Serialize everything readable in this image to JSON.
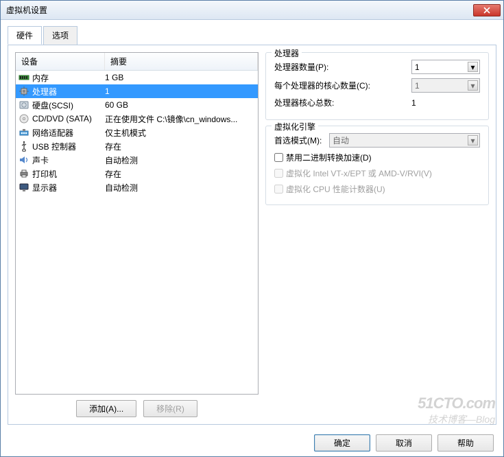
{
  "window": {
    "title": "虚拟机设置"
  },
  "tabs": {
    "hardware": "硬件",
    "options": "选项"
  },
  "list": {
    "headers": {
      "device": "设备",
      "summary": "摘要"
    },
    "rows": [
      {
        "icon": "memory-icon",
        "device": "内存",
        "summary": "1 GB",
        "selected": false
      },
      {
        "icon": "cpu-icon",
        "device": "处理器",
        "summary": "1",
        "selected": true
      },
      {
        "icon": "disk-icon",
        "device": "硬盘(SCSI)",
        "summary": "60 GB",
        "selected": false
      },
      {
        "icon": "cd-icon",
        "device": "CD/DVD (SATA)",
        "summary": "正在使用文件 C:\\镜像\\cn_windows...",
        "selected": false
      },
      {
        "icon": "nic-icon",
        "device": "网络适配器",
        "summary": "仅主机模式",
        "selected": false
      },
      {
        "icon": "usb-icon",
        "device": "USB 控制器",
        "summary": "存在",
        "selected": false
      },
      {
        "icon": "sound-icon",
        "device": "声卡",
        "summary": "自动检测",
        "selected": false
      },
      {
        "icon": "printer-icon",
        "device": "打印机",
        "summary": "存在",
        "selected": false
      },
      {
        "icon": "display-icon",
        "device": "显示器",
        "summary": "自动检测",
        "selected": false
      }
    ]
  },
  "left_buttons": {
    "add": "添加(A)...",
    "remove": "移除(R)"
  },
  "right": {
    "group_processor": {
      "title": "处理器",
      "rows": {
        "count": {
          "label": "处理器数量(P):",
          "value": "1"
        },
        "cores": {
          "label": "每个处理器的核心数量(C):",
          "value": "1"
        },
        "total": {
          "label": "处理器核心总数:",
          "value": "1"
        }
      }
    },
    "group_virt": {
      "title": "虚拟化引擎",
      "preferred_label": "首选模式(M):",
      "preferred_value": "自动",
      "checks": {
        "disable_accel": "禁用二进制转换加速(D)",
        "vt": "虚拟化 Intel VT-x/EPT 或 AMD-V/RVI(V)",
        "cpu_perf": "虚拟化 CPU 性能计数器(U)"
      }
    }
  },
  "footer": {
    "ok": "确定",
    "cancel": "取消",
    "help": "帮助"
  },
  "watermark": {
    "l1": "51CTO.com",
    "l2": "技术博客—Blog"
  }
}
